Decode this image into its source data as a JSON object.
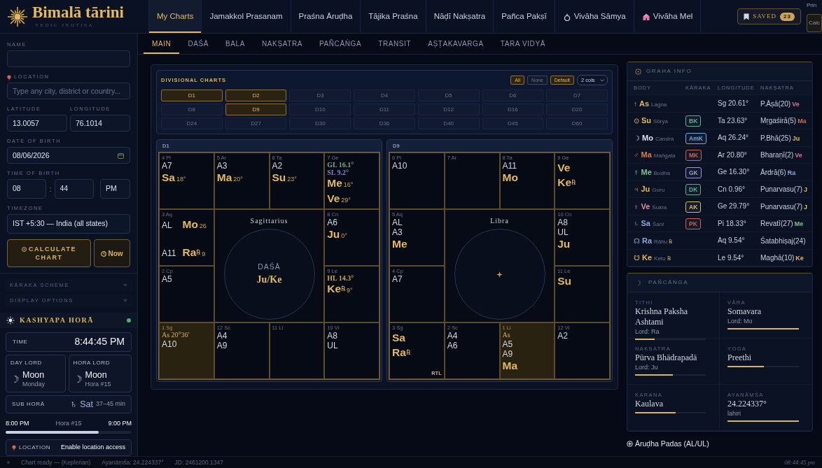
{
  "brand": {
    "title": "Bimalā tārini",
    "subtitle": "VEDIC JYOTISA"
  },
  "nav_tabs": [
    {
      "label": "My Charts",
      "selected": true,
      "kind": "plain"
    },
    {
      "label": "Jamakkol Prasanam",
      "selected": false,
      "kind": "plain"
    },
    {
      "label": "Praśna Āruḍha",
      "selected": false,
      "kind": "plain"
    },
    {
      "label": "Tājika Praśna",
      "selected": false,
      "kind": "plain"
    },
    {
      "label": "Nāḍī Nakṣatra",
      "selected": false,
      "kind": "plain"
    },
    {
      "label": "Pañca Pakṣī",
      "selected": false,
      "kind": "plain"
    },
    {
      "label": "Vivāha Sāmya",
      "selected": false,
      "kind": "ring"
    },
    {
      "label": "Vivāha Mel",
      "selected": false,
      "kind": "building"
    }
  ],
  "saved": {
    "label": "SAVED",
    "count": "23"
  },
  "clipped_controls": {
    "top": "Prin",
    "button": "Calc"
  },
  "form": {
    "name": {
      "label": "NAME"
    },
    "location": {
      "label": "LOCATION",
      "placeholder": "Type any city, district or country..."
    },
    "latitude": {
      "label": "LATITUDE",
      "value": "13.0057"
    },
    "longitude": {
      "label": "LONGITUDE",
      "value": "76.1014"
    },
    "date_of_birth": {
      "label": "DATE OF BIRTH",
      "value": "08/06/2026"
    },
    "time_of_birth": {
      "label": "TIME OF BIRTH",
      "hour": "08",
      "separator": ":",
      "minute": "44",
      "meridiem": "PM"
    },
    "timezone": {
      "label": "TIMEZONE",
      "value": "IST +5:30 — India (all states)"
    }
  },
  "actions": [
    {
      "label": "CALCULATE CHART",
      "kind": "calculate"
    },
    {
      "label": "Now",
      "kind": "now"
    }
  ],
  "sections": [
    {
      "label": "KĀRAKA SCHEME",
      "expanded": false
    },
    {
      "label": "DISPLAY OPTIONS",
      "expanded": false
    }
  ],
  "hora": {
    "title": "KASHYAPA HORĀ",
    "live": true,
    "time_label": "TIME",
    "time": "8:44:45 PM",
    "lords": [
      {
        "label": "DAY LORD",
        "symbol": "☽",
        "planet": "Moon",
        "detail": "Monday"
      },
      {
        "label": "HORA LORD",
        "symbol": "☽",
        "planet": "Moon",
        "detail": "Hora #15"
      }
    ],
    "sub_hora": {
      "label": "SUB HORĀ",
      "symbol": "♄",
      "planet": "Sat",
      "range": "37–45 min"
    },
    "progress": {
      "start": "8:00 PM",
      "middle": "Hora #15",
      "end": "9:00 PM",
      "level": 0.74
    },
    "location": {
      "label": "LOCATION",
      "action": "Enable location access"
    }
  },
  "sub_tabs": [
    {
      "label": "MAIN",
      "selected": true
    },
    {
      "label": "DAŚĀ",
      "selected": false
    },
    {
      "label": "BALA",
      "selected": false
    },
    {
      "label": "NAKṢATRA",
      "selected": false
    },
    {
      "label": "PAÑCĀṄGA",
      "selected": false
    },
    {
      "label": "TRANSIT",
      "selected": false
    },
    {
      "label": "AṢṬAKAVARGA",
      "selected": false
    },
    {
      "label": "TARA VIDYĀ",
      "selected": false
    }
  ],
  "divisional": {
    "title": "DIVISIONAL CHARTS",
    "filters": [
      {
        "label": "All",
        "active": true
      },
      {
        "label": "None",
        "active": false
      },
      {
        "label": "Default",
        "active": true
      }
    ],
    "columns": "2 cols",
    "options": [
      {
        "label": "D1",
        "selected": true
      },
      {
        "label": "D2",
        "selected": true
      },
      {
        "label": "D3",
        "selected": false
      },
      {
        "label": "D4",
        "selected": false
      },
      {
        "label": "D5",
        "selected": false
      },
      {
        "label": "D6",
        "selected": false
      },
      {
        "label": "D7",
        "selected": false
      },
      {
        "label": "D8",
        "selected": false
      },
      {
        "label": "D9",
        "selected": true
      },
      {
        "label": "D10",
        "selected": false
      },
      {
        "label": "D11",
        "selected": false
      },
      {
        "label": "D12",
        "selected": false
      },
      {
        "label": "D16",
        "selected": false
      },
      {
        "label": "D20",
        "selected": false
      },
      {
        "label": "D24",
        "selected": false
      },
      {
        "label": "D27",
        "selected": false
      },
      {
        "label": "D30",
        "selected": false
      },
      {
        "label": "D36",
        "selected": false
      },
      {
        "label": "D40",
        "selected": false
      },
      {
        "label": "D45",
        "selected": false
      },
      {
        "label": "D60",
        "selected": false
      }
    ]
  },
  "charts": [
    {
      "title": "D1",
      "lagna_sign": "Sagittarius",
      "center": {
        "label": "DAŚĀ",
        "value": "Ju/Ke"
      },
      "houses": [
        {
          "sign": "4 Pi",
          "selected": false,
          "kind": "stack",
          "items": [
            {
              "kind": "pada",
              "text": "A7"
            },
            {
              "kind": "planet",
              "text": "Sa",
              "degree": "18°"
            }
          ]
        },
        {
          "sign": "5 Ar",
          "selected": false,
          "kind": "stack",
          "items": [
            {
              "kind": "pada",
              "text": "A3"
            },
            {
              "kind": "planet",
              "text": "Ma",
              "degree": "20°"
            }
          ]
        },
        {
          "sign": "6 Ta",
          "selected": false,
          "kind": "stack",
          "items": [
            {
              "kind": "pada",
              "text": "A2"
            },
            {
              "kind": "planet",
              "text": "Su",
              "degree": "23°"
            }
          ]
        },
        {
          "sign": "7 Ge",
          "selected": false,
          "kind": "stack",
          "items": [
            {
              "kind": "point",
              "text": "GL 16.1°",
              "color": "#6fa88a"
            },
            {
              "kind": "point",
              "text": "SL 9.2°",
              "color": "#8c7fd0"
            },
            {
              "kind": "planet",
              "text": "Me",
              "degree": "16°"
            },
            {
              "kind": "planet",
              "text": "Ve",
              "degree": "29°"
            }
          ]
        },
        {
          "sign": "3 Aq",
          "selected": false,
          "kind": "split",
          "items": [
            {
              "kind": "pada",
              "text": "AL"
            },
            {
              "kind": "planet",
              "text": "Mo",
              "degree": "26"
            },
            {
              "kind": "pada",
              "text": "A11"
            },
            {
              "kind": "planet",
              "text": "Ra",
              "retro": "℞",
              "degree": "9"
            }
          ]
        },
        {
          "sign": "8 Cn",
          "selected": false,
          "kind": "stack",
          "items": [
            {
              "kind": "pada",
              "text": "A6"
            },
            {
              "kind": "planet",
              "text": "Ju",
              "degree": "0°"
            }
          ]
        },
        {
          "sign": "2 Cp",
          "selected": false,
          "kind": "stack",
          "items": [
            {
              "kind": "pada",
              "text": "A5"
            }
          ]
        },
        {
          "sign": "9 Le",
          "selected": false,
          "kind": "stack",
          "items": [
            {
              "kind": "point",
              "text": "HL 14.3°",
              "color": "#c9a45a"
            },
            {
              "kind": "planet",
              "text": "Ke",
              "retro": "℞",
              "degree": "9°"
            }
          ]
        },
        {
          "sign": "1 Sg",
          "selected": true,
          "kind": "stack",
          "items": [
            {
              "kind": "ascendant",
              "text": "As 20°36′"
            },
            {
              "kind": "pada",
              "text": "A10"
            }
          ]
        },
        {
          "sign": "12 Sc",
          "selected": false,
          "kind": "stack",
          "items": [
            {
              "kind": "pada",
              "text": "A4"
            },
            {
              "kind": "pada",
              "text": "A9"
            }
          ]
        },
        {
          "sign": "11 Li",
          "selected": false,
          "kind": "stack"
        },
        {
          "sign": "10 Vi",
          "selected": false,
          "kind": "stack",
          "items": [
            {
              "kind": "pada",
              "text": "A8"
            },
            {
              "kind": "pada",
              "text": "UL"
            }
          ]
        }
      ]
    },
    {
      "title": "D9",
      "lagna_sign": "Libra",
      "houses": [
        {
          "sign": "6 Pi",
          "selected": false,
          "kind": "stack",
          "items": [
            {
              "kind": "pada",
              "text": "A10"
            }
          ]
        },
        {
          "sign": "7 Ar",
          "selected": false,
          "kind": "stack"
        },
        {
          "sign": "8 Ta",
          "selected": false,
          "kind": "stack",
          "items": [
            {
              "kind": "pada",
              "text": "A11"
            },
            {
              "kind": "planet",
              "text": "Mo"
            }
          ]
        },
        {
          "sign": "9 Ge",
          "selected": false,
          "kind": "stack",
          "items": [
            {
              "kind": "planet",
              "text": "Ve"
            },
            {
              "kind": "planet",
              "text": "Ke",
              "retro": "℞"
            }
          ]
        },
        {
          "sign": "5 Aq",
          "selected": false,
          "kind": "stack",
          "items": [
            {
              "kind": "pada",
              "text": "AL"
            },
            {
              "kind": "pada",
              "text": "A3"
            },
            {
              "kind": "planet",
              "text": "Me"
            }
          ]
        },
        {
          "sign": "10 Cn",
          "selected": false,
          "kind": "stack",
          "items": [
            {
              "kind": "pada",
              "text": "A8"
            },
            {
              "kind": "pada",
              "text": "UL"
            },
            {
              "kind": "planet",
              "text": "Ju"
            }
          ]
        },
        {
          "sign": "4 Cp",
          "selected": false,
          "kind": "stack",
          "items": [
            {
              "kind": "pada",
              "text": "A7"
            }
          ]
        },
        {
          "sign": "11 Le",
          "selected": false,
          "kind": "stack",
          "items": [
            {
              "kind": "planet",
              "text": "Su"
            }
          ]
        },
        {
          "sign": "3 Sg",
          "selected": false,
          "kind": "stack",
          "note": "RTL",
          "items": [
            {
              "kind": "planet",
              "text": "Sa"
            },
            {
              "kind": "planet",
              "text": "Ra",
              "retro": "℞"
            }
          ]
        },
        {
          "sign": "2 Sc",
          "selected": false,
          "kind": "stack",
          "items": [
            {
              "kind": "pada",
              "text": "A4"
            },
            {
              "kind": "pada",
              "text": "A6"
            }
          ]
        },
        {
          "sign": "1 Li",
          "selected": true,
          "kind": "stack",
          "items": [
            {
              "kind": "ascendant",
              "text": "As"
            },
            {
              "kind": "pada",
              "text": "A5"
            },
            {
              "kind": "pada",
              "text": "A9"
            },
            {
              "kind": "planet",
              "text": "Ma"
            }
          ]
        },
        {
          "sign": "12 Vi",
          "selected": false,
          "kind": "stack",
          "items": [
            {
              "kind": "pada",
              "text": "A2"
            }
          ]
        }
      ]
    }
  ],
  "graha_info": {
    "title": "GRAHA INFO",
    "columns": [
      "BODY",
      "KĀRAKA",
      "LONGITUDE",
      "NAKṢATRA"
    ],
    "rows": [
      {
        "glyph": "↑",
        "abbr": "As",
        "name": "Lagna",
        "color": "#e3b95c",
        "longitude": "Sg 20.61°",
        "nakshatra": "P.Āṣā(20)",
        "lord": {
          "text": "Ve",
          "color": "#e0708a"
        }
      },
      {
        "glyph": "⊙",
        "abbr": "Su",
        "name": "Sūrya",
        "color": "#e3b95c",
        "karaka": {
          "text": "BK",
          "color": "#5fae8a"
        },
        "longitude": "Ta 23.63°",
        "nakshatra": "Mṛgaśirā(5)",
        "lord": {
          "text": "Ma",
          "color": "#d9664a"
        }
      },
      {
        "glyph": "☽",
        "abbr": "Mo",
        "name": "Candra",
        "color": "#dfe3ee",
        "karaka": {
          "text": "AmK",
          "color": "#6fa6dc"
        },
        "longitude": "Aq 26.24°",
        "nakshatra": "P.Bhā(25)",
        "lord": {
          "text": "Ju",
          "color": "#e3b95c"
        }
      },
      {
        "glyph": "♂",
        "abbr": "Ma",
        "name": "Maṅgala",
        "color": "#e07a4a",
        "karaka": {
          "text": "MK",
          "color": "#d0604a"
        },
        "longitude": "Ar 20.80°",
        "nakshatra": "Bharaṇī(2)",
        "lord": {
          "text": "Ve",
          "color": "#e0708a"
        }
      },
      {
        "glyph": "☿",
        "abbr": "Me",
        "name": "Budha",
        "color": "#7cc28e",
        "karaka": {
          "text": "GK",
          "color": "#a590dc"
        },
        "longitude": "Ge 16.30°",
        "nakshatra": "Ārdrā(6)",
        "lord": {
          "text": "Ra",
          "color": "#8fa6d8"
        }
      },
      {
        "glyph": "♃",
        "abbr": "Ju",
        "name": "Guru",
        "color": "#e3b95c",
        "karaka": {
          "text": "DK",
          "color": "#5fae8a"
        },
        "longitude": "Cn 0.96°",
        "nakshatra": "Punarvasu(7)",
        "lord": {
          "text": "J",
          "color": "#e3b95c"
        }
      },
      {
        "glyph": "♀",
        "abbr": "Ve",
        "name": "Śukra",
        "color": "#e58aa8",
        "karaka": {
          "text": "AK",
          "color": "#d8b860"
        },
        "longitude": "Ge 29.79°",
        "nakshatra": "Punarvasu(7)",
        "lord": {
          "text": "J",
          "color": "#e3b95c"
        }
      },
      {
        "glyph": "♄",
        "abbr": "Sa",
        "name": "Śani",
        "color": "#8fa6d8",
        "karaka": {
          "text": "PK",
          "color": "#d0604a"
        },
        "longitude": "Pi 18.33°",
        "nakshatra": "Revatī(27)",
        "lord": {
          "text": "Me",
          "color": "#7cc28e"
        }
      },
      {
        "glyph": "☊",
        "abbr": "Ra",
        "name": "Rāhu",
        "retro": "℞",
        "color": "#8fa6d8",
        "longitude": "Aq 9.54°",
        "nakshatra": "Śatabhiṣaj(24)"
      },
      {
        "glyph": "☋",
        "abbr": "Ke",
        "name": "Ketu",
        "retro": "℞",
        "color": "#e3b95c",
        "longitude": "Le 9.54°",
        "nakshatra": "Maghā(10)",
        "lord": {
          "text": "Ke",
          "color": "#e3b95c"
        }
      }
    ]
  },
  "panchanga": {
    "title": "PAÑCĀṄGA",
    "items": [
      {
        "label": "TITHI",
        "value": "Krishna Paksha Ashtami",
        "detail": "Lord: Ra",
        "level": 0.28
      },
      {
        "label": "VĀRA",
        "value": "Somavara",
        "detail": "Lord: Mo",
        "level": 1.0
      },
      {
        "label": "NAKṢATRA",
        "value": "Pūrva Bhādrapadā",
        "detail": "Lord: Ju",
        "level": 0.53
      },
      {
        "label": "YOGA",
        "value": "Preethi",
        "level": 0.51
      },
      {
        "label": "KARANA",
        "value": "Kaulava",
        "level": 0.57
      },
      {
        "label": "AYANĀṂŚA",
        "value": "24.224337°",
        "detail": "lahiri",
        "level": 1.0
      }
    ]
  },
  "arudha_toggle": {
    "label": "Āruḍha Padas (AL/UL)"
  },
  "status_bar": {
    "items": [
      "Chart ready — (Keplerian)",
      "Ayanāṃśa: 24.224337°",
      "JD: 2461200.1347"
    ],
    "clock": "08:44:45 pm"
  }
}
